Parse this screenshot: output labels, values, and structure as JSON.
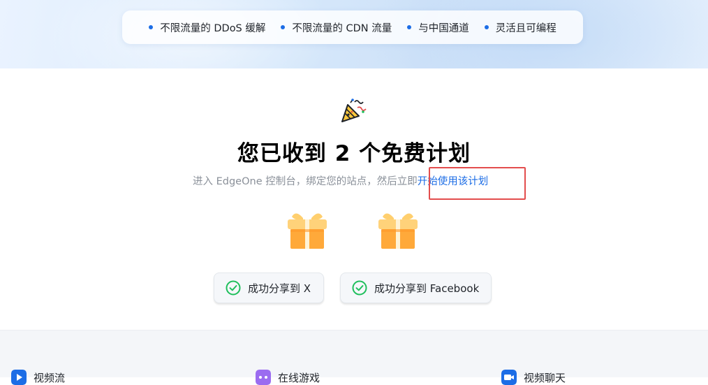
{
  "features": [
    {
      "label": "不限流量的 DDoS 缓解"
    },
    {
      "label": "不限流量的 CDN 流量"
    },
    {
      "label": "与中国通道"
    },
    {
      "label": "灵活且可编程"
    }
  ],
  "main": {
    "title": "您已收到 2 个免费计划",
    "subtitle_prefix": "进入 EdgeOne 控制台，绑定您的站点，然后立即",
    "subtitle_link": "开始使用该计划"
  },
  "share": {
    "x_label": "成功分享到 X",
    "facebook_label": "成功分享到 Facebook"
  },
  "categories": [
    {
      "label": "视频流"
    },
    {
      "label": "在线游戏"
    },
    {
      "label": "视频聊天"
    }
  ],
  "colors": {
    "accent": "#1c6de6",
    "success": "#1fbf5c",
    "highlight": "#e34d4d",
    "gift": "#ffa93a"
  }
}
